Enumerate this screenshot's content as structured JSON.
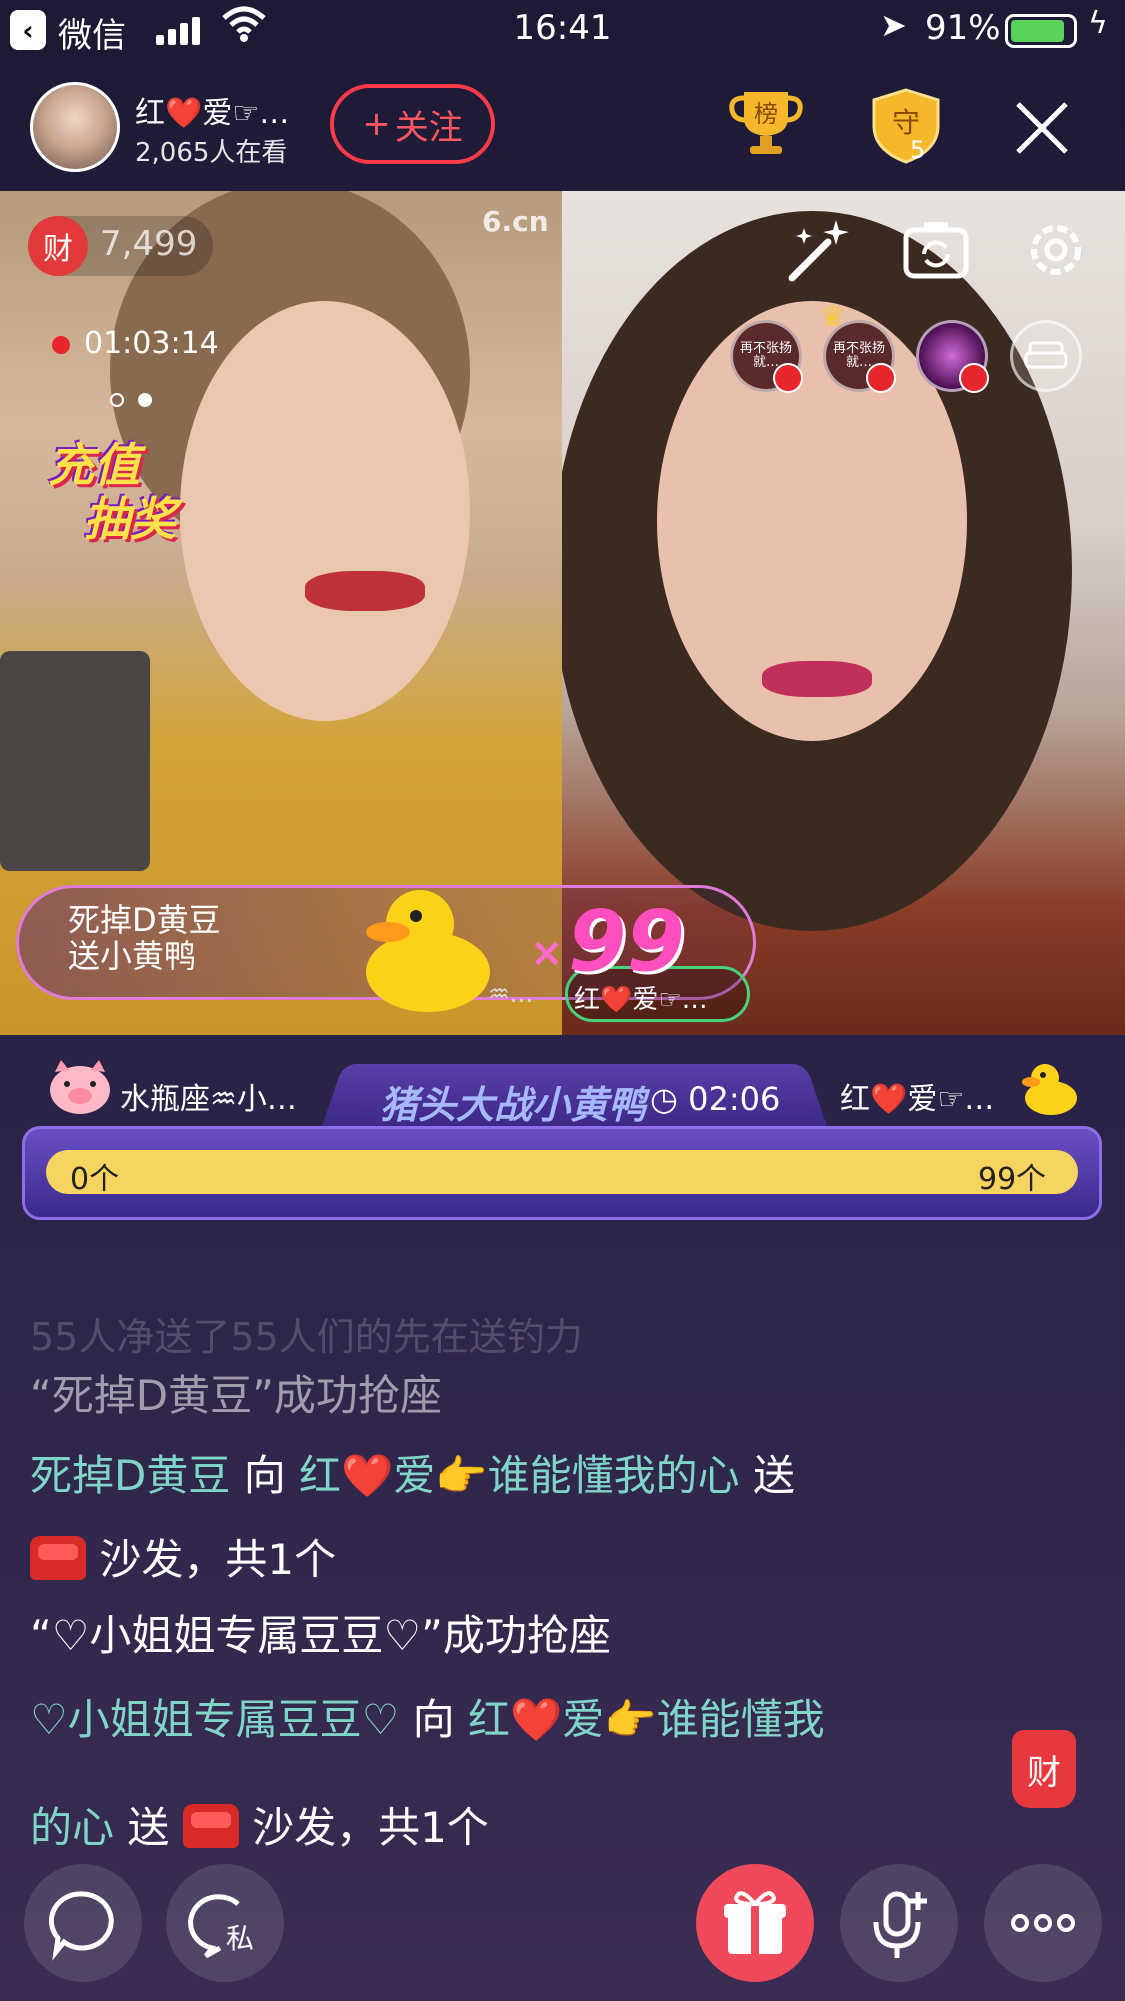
{
  "status_bar": {
    "back_app": "微信",
    "time": "16:41",
    "battery_pct": "91%"
  },
  "header": {
    "host_name": "红❤️爱☞…",
    "viewer_count": "2,065人在看",
    "follow_label": "关注",
    "follow_plus": "+",
    "rank_label": "榜",
    "guard_label": "守",
    "guard_count": "5"
  },
  "video": {
    "wealth_icon": "财",
    "wealth_value": "7,499",
    "watermark": "6.cn",
    "live_timer": "01:03:14",
    "recharge_line1": "充值",
    "recharge_line2": "抽奖",
    "seats": [
      {
        "text": "再不张扬就…"
      },
      {
        "text": "再不张扬就…"
      }
    ]
  },
  "gift_banner": {
    "sender_line1": "死掉D黄豆",
    "sender_line2": "送小黄鸭",
    "multiplier": "×",
    "count": "99",
    "target": "红❤️爱☞…",
    "prev_target": "♒…"
  },
  "pk": {
    "left_name": "水瓶座♒小…",
    "title": "猪头大战小黄鸭",
    "timer": "02:06",
    "right_name": "红❤️爱☞…",
    "left_count": "0个",
    "right_count": "99个"
  },
  "chat": {
    "faded": "55人净送了55人们的先在送钓力",
    "msg1": "“死掉D黄豆”成功抢座",
    "msg2_user": "死掉D黄豆",
    "msg2_to": " 向 ",
    "msg2_host": "红❤️爱👉谁能懂我的心",
    "msg2_send": " 送",
    "msg3": " 沙发，共1个",
    "msg4": "“♡小姐姐专属豆豆♡”成功抢座",
    "msg5_user": "♡小姐姐专属豆豆♡",
    "msg5_to": " 向 ",
    "msg5_host1": "红❤️爱👉谁能懂我",
    "msg5_host2": "的心",
    "msg5_send": " 送 ",
    "msg5_rest": " 沙发，共1个",
    "wealth_float": "财"
  },
  "bottom": {
    "private_label": "私"
  }
}
